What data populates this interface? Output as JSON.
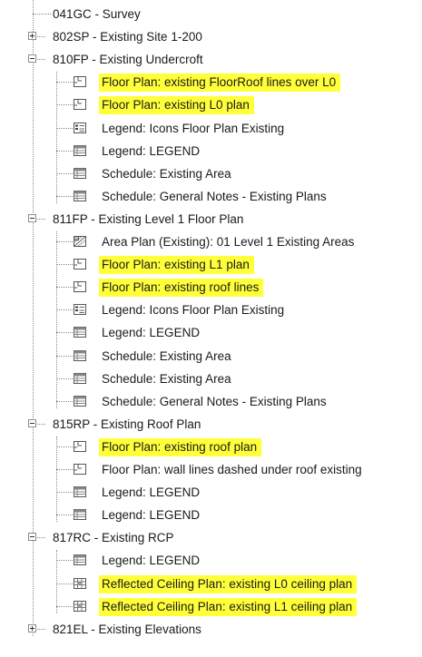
{
  "tree": {
    "items": [
      {
        "label": "041GC - Survey",
        "level": 0,
        "type": "leaf",
        "highlight": false
      },
      {
        "label": "802SP - Existing Site 1-200",
        "level": 0,
        "type": "collapsed",
        "highlight": false
      },
      {
        "label": "810FP - Existing Undercroft",
        "level": 0,
        "type": "expanded",
        "highlight": false
      },
      {
        "label": "Floor Plan: existing FloorRoof lines over L0",
        "level": 1,
        "icon": "floor-plan-icon",
        "highlight": true
      },
      {
        "label": "Floor Plan: existing L0 plan",
        "level": 1,
        "icon": "floor-plan-icon",
        "highlight": true
      },
      {
        "label": "Legend: Icons Floor Plan Existing",
        "level": 1,
        "icon": "legend-icon",
        "highlight": false
      },
      {
        "label": "Legend: LEGEND",
        "level": 1,
        "icon": "schedule-icon",
        "highlight": false
      },
      {
        "label": "Schedule: Existing Area",
        "level": 1,
        "icon": "schedule-icon",
        "highlight": false
      },
      {
        "label": "Schedule: General Notes - Existing Plans",
        "level": 1,
        "icon": "schedule-icon",
        "highlight": false
      },
      {
        "label": "811FP - Existing Level 1 Floor Plan",
        "level": 0,
        "type": "expanded",
        "highlight": false
      },
      {
        "label": "Area Plan (Existing): 01 Level 1 Existing Areas",
        "level": 1,
        "icon": "area-plan-icon",
        "highlight": false
      },
      {
        "label": "Floor Plan: existing L1 plan",
        "level": 1,
        "icon": "floor-plan-icon",
        "highlight": true
      },
      {
        "label": "Floor Plan: existing roof lines",
        "level": 1,
        "icon": "floor-plan-icon",
        "highlight": true
      },
      {
        "label": "Legend: Icons Floor Plan Existing",
        "level": 1,
        "icon": "legend-icon",
        "highlight": false
      },
      {
        "label": "Legend: LEGEND",
        "level": 1,
        "icon": "schedule-icon",
        "highlight": false
      },
      {
        "label": "Schedule: Existing Area",
        "level": 1,
        "icon": "schedule-icon",
        "highlight": false
      },
      {
        "label": "Schedule: Existing Area",
        "level": 1,
        "icon": "schedule-icon",
        "highlight": false
      },
      {
        "label": "Schedule: General Notes - Existing Plans",
        "level": 1,
        "icon": "schedule-icon",
        "highlight": false
      },
      {
        "label": "815RP - Existing Roof Plan",
        "level": 0,
        "type": "expanded",
        "highlight": false
      },
      {
        "label": "Floor Plan: existing roof plan",
        "level": 1,
        "icon": "floor-plan-icon",
        "highlight": true
      },
      {
        "label": "Floor Plan: wall lines dashed under roof existing",
        "level": 1,
        "icon": "floor-plan-icon",
        "highlight": false
      },
      {
        "label": "Legend: LEGEND",
        "level": 1,
        "icon": "schedule-icon",
        "highlight": false
      },
      {
        "label": "Legend: LEGEND",
        "level": 1,
        "icon": "schedule-icon",
        "highlight": false
      },
      {
        "label": "817RC - Existing RCP",
        "level": 0,
        "type": "expanded",
        "highlight": false
      },
      {
        "label": "Legend: LEGEND",
        "level": 1,
        "icon": "schedule-icon",
        "highlight": false
      },
      {
        "label": "Reflected Ceiling Plan: existing L0 ceiling plan",
        "level": 1,
        "icon": "ceiling-plan-icon",
        "highlight": true
      },
      {
        "label": "Reflected Ceiling Plan: existing L1 ceiling plan",
        "level": 1,
        "icon": "ceiling-plan-icon",
        "highlight": true
      },
      {
        "label": "821EL - Existing Elevations",
        "level": 0,
        "type": "collapsed",
        "highlight": false
      }
    ]
  },
  "colors": {
    "highlight": "#ffff3a",
    "text": "#1a1a1a",
    "tree_lines": "#8a8a8a"
  }
}
